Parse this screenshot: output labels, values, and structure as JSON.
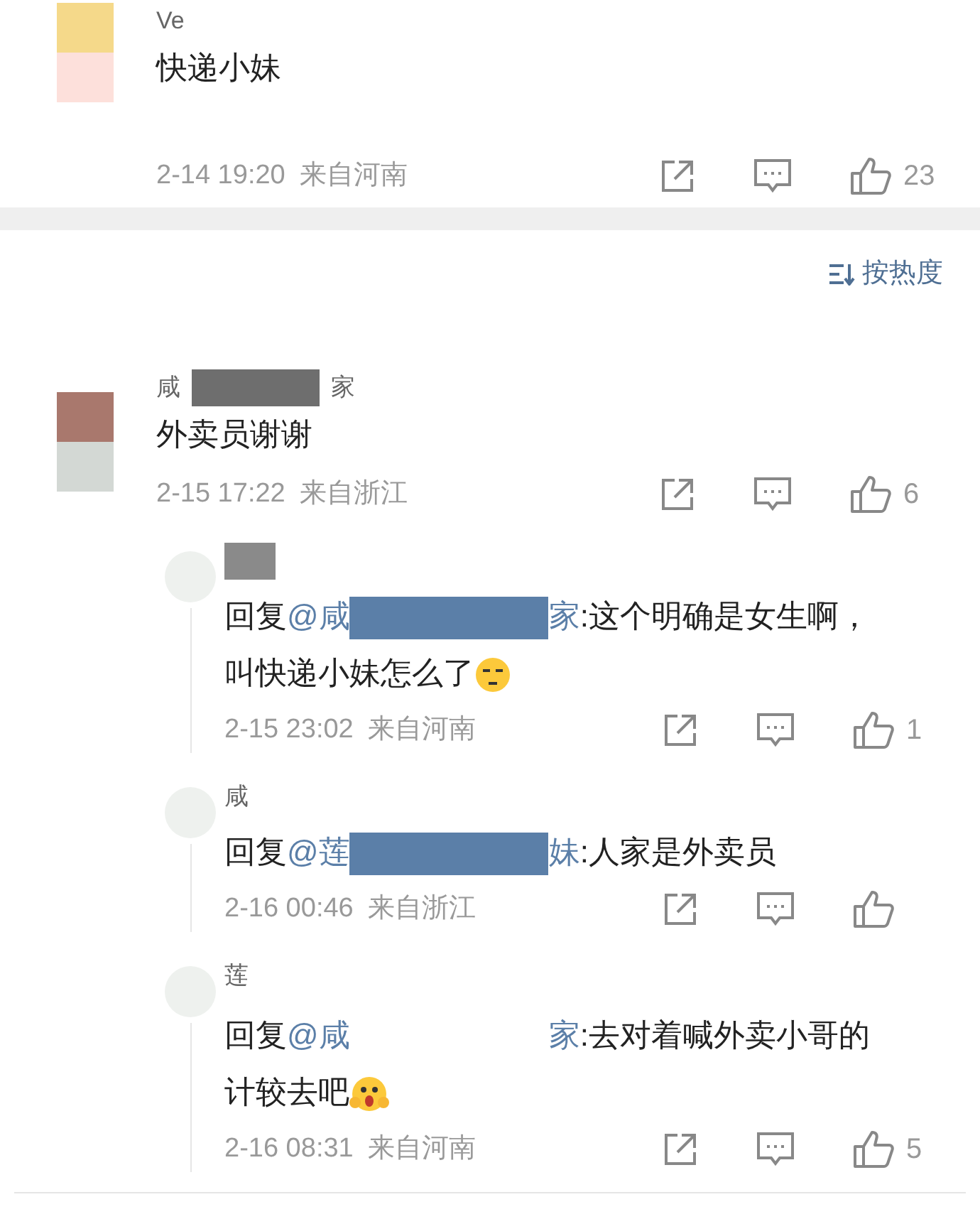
{
  "comments": [
    {
      "name_parts": [
        "Ve"
      ],
      "content": [
        {
          "kind": "text",
          "text": "快递小妹"
        }
      ],
      "time": "2-14 19:20",
      "location": "来自河南",
      "likes": "23"
    },
    {
      "name_parts": [
        "咸",
        "家"
      ],
      "content": [
        {
          "kind": "text",
          "text": "外卖员谢谢"
        }
      ],
      "time": "2-15 17:22",
      "location": "来自浙江",
      "likes": "6",
      "replies": [
        {
          "content": [
            {
              "kind": "text",
              "text": "回复"
            },
            {
              "kind": "mention",
              "text": "@咸"
            },
            {
              "kind": "redaction",
              "color": "#5b7fa8"
            },
            {
              "kind": "mention",
              "text": "家"
            },
            {
              "kind": "text",
              "text": ":这个明确是女生啊，叫快递小妹怎么了"
            },
            {
              "kind": "smirk_emoji"
            }
          ],
          "time": "2-15 23:02",
          "location": "来自河南",
          "likes": "1"
        },
        {
          "name_parts": [
            "咸"
          ],
          "content": [
            {
              "kind": "text",
              "text": "回复"
            },
            {
              "kind": "mention",
              "text": "@莲"
            },
            {
              "kind": "redaction",
              "color": "#5b7fa8"
            },
            {
              "kind": "mention",
              "text": "妹"
            },
            {
              "kind": "text",
              "text": ":人家是外卖员"
            }
          ],
          "time": "2-16 00:46",
          "location": "来自浙江"
        },
        {
          "name_parts": [
            "莲"
          ],
          "content": [
            {
              "kind": "text",
              "text": "回复"
            },
            {
              "kind": "mention",
              "text": "@咸"
            },
            {
              "kind": "gap"
            },
            {
              "kind": "mention",
              "text": "家"
            },
            {
              "kind": "text",
              "text": ":去对着喊外卖小哥的计较去吧"
            },
            {
              "kind": "scream_emoji"
            }
          ],
          "time": "2-16 08:31",
          "location": "来自河南",
          "likes": "5"
        }
      ]
    }
  ],
  "sort": {
    "label": "按热度"
  }
}
